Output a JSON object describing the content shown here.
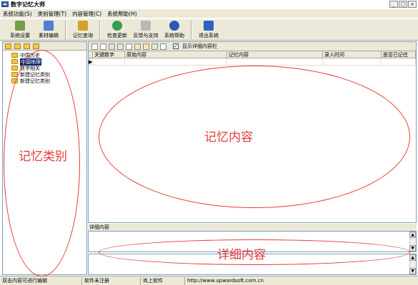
{
  "window": {
    "title": "数字记忆大师",
    "minimize": "_",
    "maximize": "□",
    "close": "×"
  },
  "menu": [
    "系统功能(S)",
    "类别管理(T)",
    "内容管理(C)",
    "系统帮助(H)"
  ],
  "toolbar": {
    "buttons": [
      {
        "label": "系统设置",
        "icon": "settings-icon",
        "color": "#7a9c4d"
      },
      {
        "label": "素材编辑",
        "icon": "edit-icon",
        "color": "#4f7fd0"
      },
      {
        "label": "记忆查询",
        "icon": "query-icon",
        "color": "#d4a12a"
      },
      {
        "label": "检查更新",
        "icon": "update-icon",
        "color": "#3a9a4a"
      },
      {
        "label": "反馈与支持",
        "icon": "mail-icon",
        "color": "#b8b8b8"
      },
      {
        "label": "系统帮助",
        "icon": "help-icon",
        "color": "#2b58b8"
      },
      {
        "label": "退出系统",
        "icon": "exit-icon",
        "color": "#2c63c2"
      }
    ]
  },
  "tree": {
    "items": [
      {
        "label": "中国历史",
        "selected": false
      },
      {
        "label": "中国地理",
        "selected": true
      },
      {
        "label": "数学相关",
        "selected": false
      },
      {
        "label": "新建记忆类别",
        "selected": false
      },
      {
        "label": "新建记忆类别",
        "selected": false
      }
    ]
  },
  "right_toolbar": {
    "checkbox_label": "显示详细内容栏",
    "checkbox_checked": true,
    "checkmark": "✓"
  },
  "table": {
    "columns": [
      "关键数字",
      "原始内容",
      "记忆内容",
      "录入时间",
      "是否已记住"
    ],
    "row_indicator": "▶"
  },
  "detail": {
    "label": "详细内容"
  },
  "status": {
    "cells": [
      "双击内容可进行编辑",
      "软件未注册",
      "尚上软件",
      "http://www.upwardsoft.com.cn"
    ]
  },
  "annotations": {
    "left": "记忆类别",
    "center": "记忆内容",
    "bottom": "详细内容",
    "color": "#e43b3b"
  },
  "scroll": {
    "up": "▲",
    "down": "▼"
  }
}
